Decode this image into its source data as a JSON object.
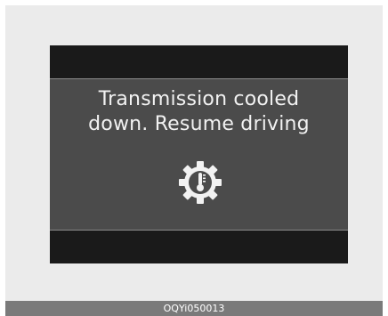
{
  "display": {
    "message_line1": "Transmission cooled",
    "message_line2": "down. Resume driving",
    "icon": "transmission-temperature-gear-icon"
  },
  "caption": {
    "code": "OQYi050013"
  },
  "colors": {
    "display_background": "#1a1a1a",
    "panel_background": "#4b4b4b",
    "text": "#f2f2f2",
    "caption_bar": "#7a7a7a"
  }
}
